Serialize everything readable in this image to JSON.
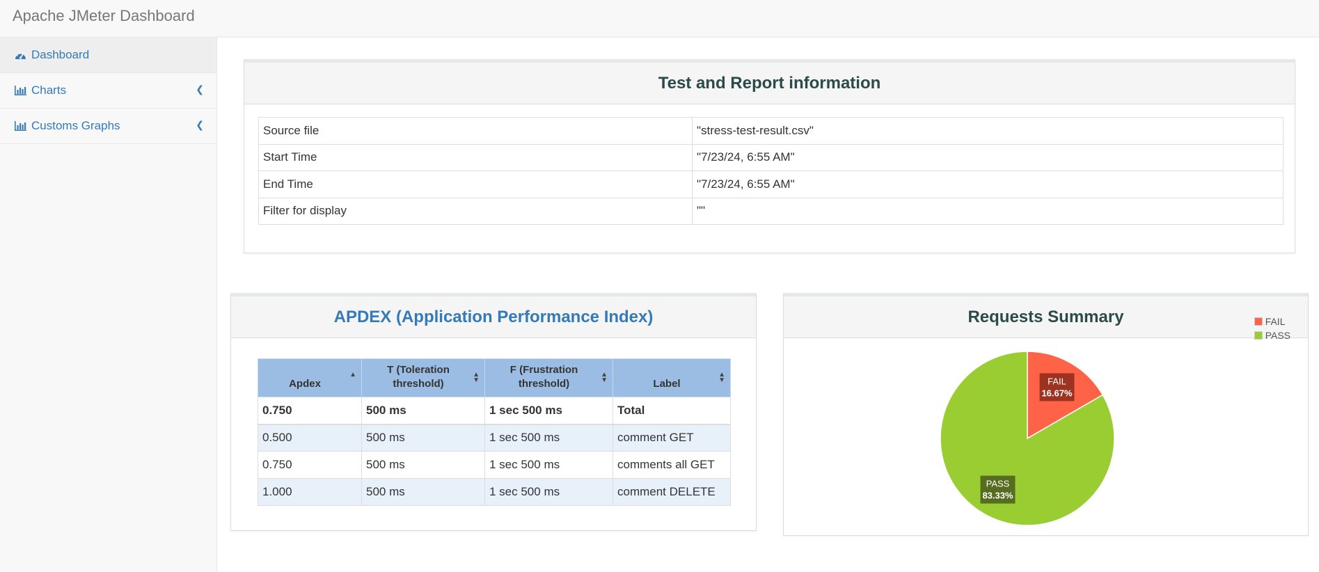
{
  "app": {
    "title": "Apache JMeter Dashboard"
  },
  "sidebar": {
    "items": [
      {
        "label": "Dashboard",
        "icon": "dashboard-icon"
      },
      {
        "label": "Charts",
        "icon": "bar-chart-icon"
      },
      {
        "label": "Customs Graphs",
        "icon": "bar-chart-icon"
      }
    ]
  },
  "report_info": {
    "title": "Test and Report information",
    "rows": [
      {
        "key": "Source file",
        "value": "\"stress-test-result.csv\""
      },
      {
        "key": "Start Time",
        "value": "\"7/23/24, 6:55 AM\""
      },
      {
        "key": "End Time",
        "value": "\"7/23/24, 6:55 AM\""
      },
      {
        "key": "Filter for display",
        "value": "\"\""
      }
    ]
  },
  "apdex": {
    "title": "APDEX (Application Performance Index)",
    "headers": [
      "Apdex",
      "T (Toleration threshold)",
      "F (Frustration threshold)",
      "Label"
    ],
    "total": [
      "0.750",
      "500 ms",
      "1 sec 500 ms",
      "Total"
    ],
    "rows": [
      [
        "0.500",
        "500 ms",
        "1 sec 500 ms",
        "comment GET"
      ],
      [
        "0.750",
        "500 ms",
        "1 sec 500 ms",
        "comments all GET"
      ],
      [
        "1.000",
        "500 ms",
        "1 sec 500 ms",
        "comment DELETE"
      ]
    ]
  },
  "requests_summary": {
    "title": "Requests Summary",
    "slice_labels": [
      {
        "name": "FAIL",
        "pct": "16.67%"
      },
      {
        "name": "PASS",
        "pct": "83.33%"
      }
    ]
  },
  "colors": {
    "link": "#337ab7",
    "fail": "#ff6347",
    "pass": "#9acd32",
    "table_header": "#9cbde3"
  },
  "chart_data": {
    "type": "pie",
    "title": "Requests Summary",
    "labels": [
      "FAIL",
      "PASS"
    ],
    "values": [
      16.67,
      83.33
    ],
    "colors": [
      "#ff6347",
      "#9acd32"
    ],
    "legend_position": "top-right"
  }
}
